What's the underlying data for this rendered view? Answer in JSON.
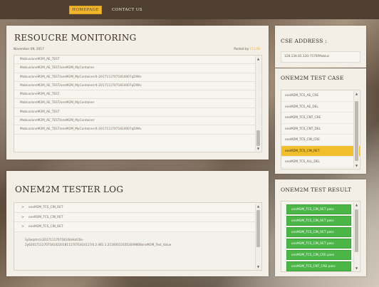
{
  "nav": {
    "home_label": "HOMEPAGE",
    "contact_label": "CONTACT US"
  },
  "monitor": {
    "title": "RESOUCRE MONITORING",
    "date": "November 09, 2017",
    "posted_by_label": "Posted by",
    "author": "CCLAB",
    "items": [
      "Mobius/oneM2M_AE_TEST",
      "Mobius/oneM2M_AE_TEST/oneM2M_MyContainer",
      "Mobius/oneM2M_AE_TEST/oneM2M_MyContainer/4-20171117071814007qDlWv",
      "Mobius/oneM2M_AE_TEST/oneM2M_MyContainer/4-20171117071814007qDlWv",
      "Mobius/oneM2M_AE_TEST",
      "Mobius/oneM2M_AE_TEST/oneM2M_MyContainer",
      "Mobius/oneM2M_AE_TEST",
      "Mobius/oneM2M_AE_TEST/oneM2M_MyContainer",
      "Mobius/oneM2M_AE_TEST/oneM2M_MyContainer/4-20171117071814007qDlWv"
    ]
  },
  "log": {
    "title": "ONEM2M TESTER LOG",
    "rows": [
      "oneM2M_TCS_CIN_RET",
      "oneM2M_TCS_CIN_RET",
      "oneM2M_TCS_CIN_RET"
    ],
    "detail_line1": "SySeqdrrcis20171117071814kHkdC6a-",
    "detail_line2": "2y620171117071814220181117071814117/0.2.481.1.211600131052049808oneM2M_Test_Value"
  },
  "cse": {
    "title": "CSE ADDRESS :",
    "value": "128.134.65.120:7579/Mobius"
  },
  "testcase": {
    "title": "ONEM2M TEST CASE",
    "items": [
      "oneM2M_TCS_AE_CRE",
      "oneM2M_TCS_AE_DEL",
      "oneM2M_TCS_CNT_CRE",
      "oneM2M_TCS_CNT_DEL",
      "oneM2M_TCS_CIN_CRE",
      "oneM2M_TCS_CIN_RET",
      "oneM2M_TCS_ALL_DEL"
    ]
  },
  "result": {
    "title": "ONEM2M TEST RESULT",
    "items": [
      "oneM2M_TCS_CIN_RET pass",
      "oneM2M_TCS_CIN_RET pass",
      "oneM2M_TCS_CIN_RET pass",
      "oneM2M_TCS_CIN_RET pass",
      "oneM2M_TCS_CIN_CRE pass",
      "oneM2M_TCS_CNT_CRE pass"
    ]
  },
  "colors": {
    "accent": "#f1b52c",
    "pass": "#4cb548",
    "topbar": "#4e3f30",
    "panel": "#f3efe6"
  }
}
